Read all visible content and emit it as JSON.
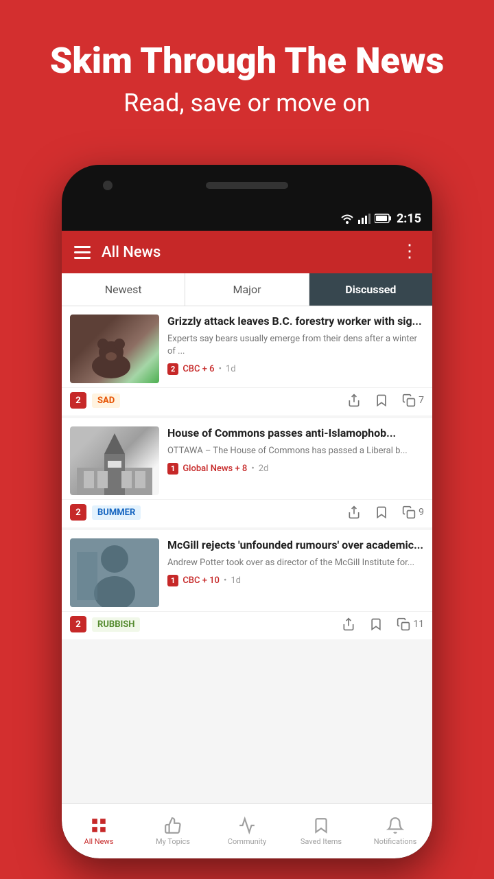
{
  "background": {
    "headline": "Skim Through The News",
    "subheadline": "Read, save or move on"
  },
  "status_bar": {
    "time": "2:15"
  },
  "toolbar": {
    "title": "All News"
  },
  "sort_tabs": [
    {
      "label": "Newest",
      "active": false
    },
    {
      "label": "Major",
      "active": false
    },
    {
      "label": "Discussed",
      "active": true
    }
  ],
  "news_items": [
    {
      "title": "Grizzly attack leaves B.C. forestry worker with sig...",
      "excerpt": "Experts say bears usually emerge from their dens after a winter of ...",
      "source_badge": "2",
      "source_name": "CBC + 6",
      "time": "1d",
      "reaction_num": "2",
      "reaction_label": "SAD",
      "share_icon": "share",
      "bookmark_icon": "bookmark",
      "copy_count": "7",
      "thumb_type": "bear"
    },
    {
      "title": "House of Commons passes anti-Islamophob...",
      "excerpt": "OTTAWA – The House of Commons has passed a Liberal b...",
      "source_badge": "1",
      "source_name": "Global News + 8",
      "time": "2d",
      "reaction_num": "2",
      "reaction_label": "BUMMER",
      "share_icon": "share",
      "bookmark_icon": "bookmark",
      "copy_count": "9",
      "thumb_type": "parliament"
    },
    {
      "title": "McGill rejects 'unfounded rumours' over academic...",
      "excerpt": "Andrew Potter took over as director of the McGill Institute for...",
      "source_badge": "1",
      "source_name": "CBC + 10",
      "time": "1d",
      "reaction_num": "2",
      "reaction_label": "RUBBISH",
      "share_icon": "share",
      "bookmark_icon": "bookmark",
      "copy_count": "11",
      "thumb_type": "mcgill"
    }
  ],
  "bottom_nav": [
    {
      "label": "All News",
      "active": true,
      "icon": "grid"
    },
    {
      "label": "My Topics",
      "active": false,
      "icon": "thumb"
    },
    {
      "label": "Community",
      "active": false,
      "icon": "pulse"
    },
    {
      "label": "Saved Items",
      "active": false,
      "icon": "bookmark"
    },
    {
      "label": "Notifications",
      "active": false,
      "icon": "bell"
    }
  ]
}
